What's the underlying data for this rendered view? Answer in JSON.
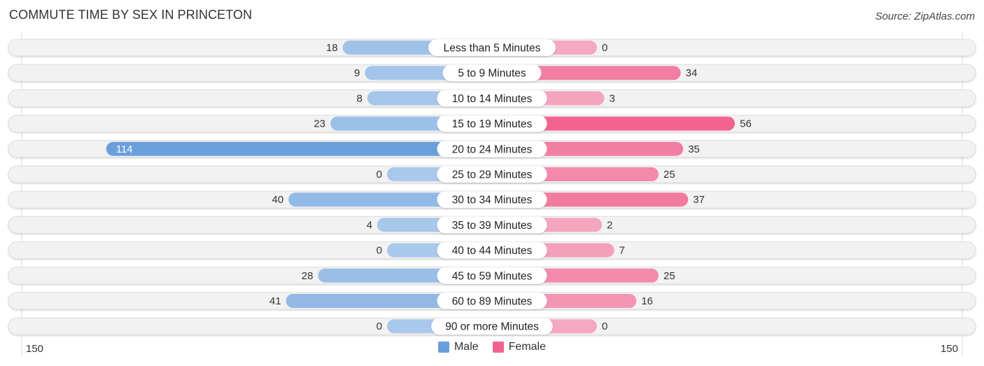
{
  "header": {
    "title": "COMMUTE TIME BY SEX IN PRINCETON",
    "source": "Source: ZipAtlas.com"
  },
  "colors": {
    "male": "#6a9fdb",
    "male_light": "#a9c8ec",
    "female": "#f0648f",
    "female_light": "#f5a8c1",
    "row_bg": "#f2f2f2"
  },
  "legend": [
    {
      "label": "Male",
      "color": "#6a9fdb"
    },
    {
      "label": "Female",
      "color": "#f0648f"
    }
  ],
  "chart_data": {
    "type": "bar",
    "orientation": "horizontal-diverging",
    "title": "COMMUTE TIME BY SEX IN PRINCETON",
    "categories": [
      "Less than 5 Minutes",
      "5 to 9 Minutes",
      "10 to 14 Minutes",
      "15 to 19 Minutes",
      "20 to 24 Minutes",
      "25 to 29 Minutes",
      "30 to 34 Minutes",
      "35 to 39 Minutes",
      "40 to 44 Minutes",
      "45 to 59 Minutes",
      "60 to 89 Minutes",
      "90 or more Minutes"
    ],
    "series": [
      {
        "name": "Male",
        "values": [
          18,
          9,
          8,
          23,
          114,
          0,
          40,
          4,
          0,
          28,
          41,
          0
        ]
      },
      {
        "name": "Female",
        "values": [
          0,
          34,
          3,
          56,
          35,
          25,
          37,
          2,
          7,
          25,
          16,
          0
        ]
      }
    ],
    "axis_left_label": "150",
    "axis_right_label": "150",
    "xlim": [
      -150,
      150
    ],
    "legend_position": "bottom-center",
    "grid": false
  }
}
